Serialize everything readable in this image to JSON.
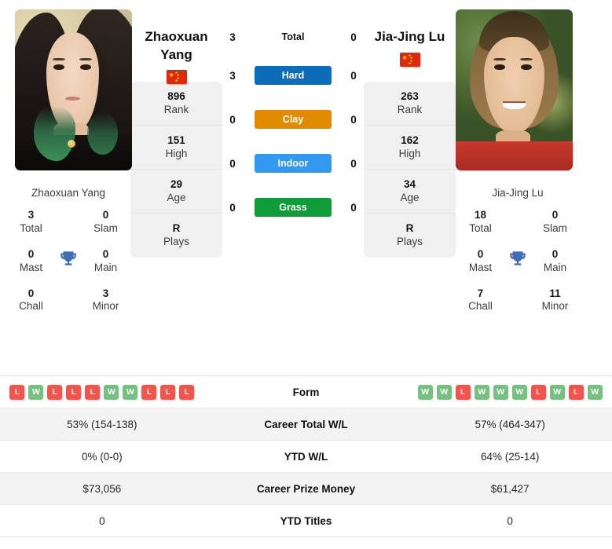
{
  "players": {
    "left": {
      "name_line1": "Zhaoxuan",
      "name_line2": "Yang",
      "full_name": "Zhaoxuan Yang",
      "flag": "china-flag",
      "rank": "896",
      "rank_label": "Rank",
      "high": "151",
      "high_label": "High",
      "age": "29",
      "age_label": "Age",
      "plays": "R",
      "plays_label": "Plays",
      "titles": {
        "total": "3",
        "total_label": "Total",
        "slam": "0",
        "slam_label": "Slam",
        "mast": "0",
        "mast_label": "Mast",
        "main": "0",
        "main_label": "Main",
        "chall": "0",
        "chall_label": "Chall",
        "minor": "3",
        "minor_label": "Minor"
      },
      "form": [
        "L",
        "W",
        "L",
        "L",
        "L",
        "W",
        "W",
        "L",
        "L",
        "L"
      ],
      "career_wl": "53% (154-138)",
      "ytd_wl": "0% (0-0)",
      "prize": "$73,056",
      "ytd_titles": "0"
    },
    "right": {
      "name_line1": "Jia-Jing Lu",
      "name_line2": "",
      "full_name": "Jia-Jing Lu",
      "flag": "china-flag",
      "rank": "263",
      "rank_label": "Rank",
      "high": "162",
      "high_label": "High",
      "age": "34",
      "age_label": "Age",
      "plays": "R",
      "plays_label": "Plays",
      "titles": {
        "total": "18",
        "total_label": "Total",
        "slam": "0",
        "slam_label": "Slam",
        "mast": "0",
        "mast_label": "Mast",
        "main": "0",
        "main_label": "Main",
        "chall": "7",
        "chall_label": "Chall",
        "minor": "11",
        "minor_label": "Minor"
      },
      "form": [
        "W",
        "W",
        "L",
        "W",
        "W",
        "W",
        "L",
        "W",
        "L",
        "W"
      ],
      "career_wl": "57% (464-347)",
      "ytd_wl": "64% (25-14)",
      "prize": "$61,427",
      "ytd_titles": "0"
    }
  },
  "head_to_head": {
    "rows": [
      {
        "label": "Total",
        "left": "3",
        "right": "0",
        "badge": false,
        "color": ""
      },
      {
        "label": "Hard",
        "left": "3",
        "right": "0",
        "badge": true,
        "color": "#0c6cb8"
      },
      {
        "label": "Clay",
        "left": "0",
        "right": "0",
        "badge": true,
        "color": "#e08b00"
      },
      {
        "label": "Indoor",
        "left": "0",
        "right": "0",
        "badge": true,
        "color": "#3399f0"
      },
      {
        "label": "Grass",
        "left": "0",
        "right": "0",
        "badge": true,
        "color": "#0f9d3a"
      }
    ]
  },
  "table": {
    "rows": [
      {
        "label": "Form",
        "left": "",
        "right": "",
        "type": "form",
        "shaded": false
      },
      {
        "label": "Career Total W/L",
        "left": "53% (154-138)",
        "right": "57% (464-347)",
        "type": "text",
        "shaded": true
      },
      {
        "label": "YTD W/L",
        "left": "0% (0-0)",
        "right": "64% (25-14)",
        "type": "text",
        "shaded": false
      },
      {
        "label": "Career Prize Money",
        "left": "$73,056",
        "right": "$61,427",
        "type": "text",
        "shaded": true
      },
      {
        "label": "YTD Titles",
        "left": "0",
        "right": "0",
        "type": "text",
        "shaded": false
      }
    ]
  },
  "colors": {
    "win_badge": "#77c180",
    "loss_badge": "#f0564a",
    "trophy": "#3f6eb5",
    "card_bg": "#f0f0f0",
    "row_shaded": "#f3f3f3"
  }
}
